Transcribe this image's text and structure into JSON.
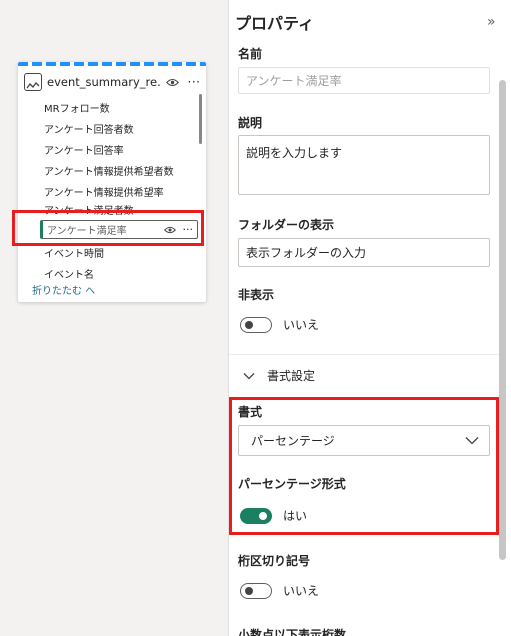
{
  "card": {
    "title": "event_summary_re...",
    "fields": [
      "MRフォロー数",
      "アンケート回答者数",
      "アンケート回答率",
      "アンケート情報提供希望者数",
      "アンケート情報提供希望率",
      "アンケート満足者数",
      "アンケート満足率",
      "イベント時間",
      "イベント名"
    ],
    "selected_field": "アンケート満足率",
    "more_glyph": "···",
    "collapse_label": "折りたたむ へ"
  },
  "panel": {
    "title": "プロパティ",
    "expand_glyph": "»",
    "name_label": "名前",
    "name_value": "アンケート満足率",
    "description_label": "説明",
    "description_placeholder": "説明を入力します",
    "folder_label": "フォルダーの表示",
    "folder_placeholder": "表示フォルダーの入力",
    "hidden_label": "非表示",
    "hidden_value": "いいえ",
    "format_section": "書式設定",
    "format_label": "書式",
    "format_value": "パーセンテージ",
    "percent_label": "パーセンテージ形式",
    "percent_value": "はい",
    "thousands_label": "桁区切り記号",
    "thousands_value": "いいえ",
    "decimal_label": "小数点以下表示桁数"
  },
  "colors": {
    "accent": "#1b7f62",
    "highlight": "#e81e1e",
    "selection_dash": "#1e90ff"
  }
}
